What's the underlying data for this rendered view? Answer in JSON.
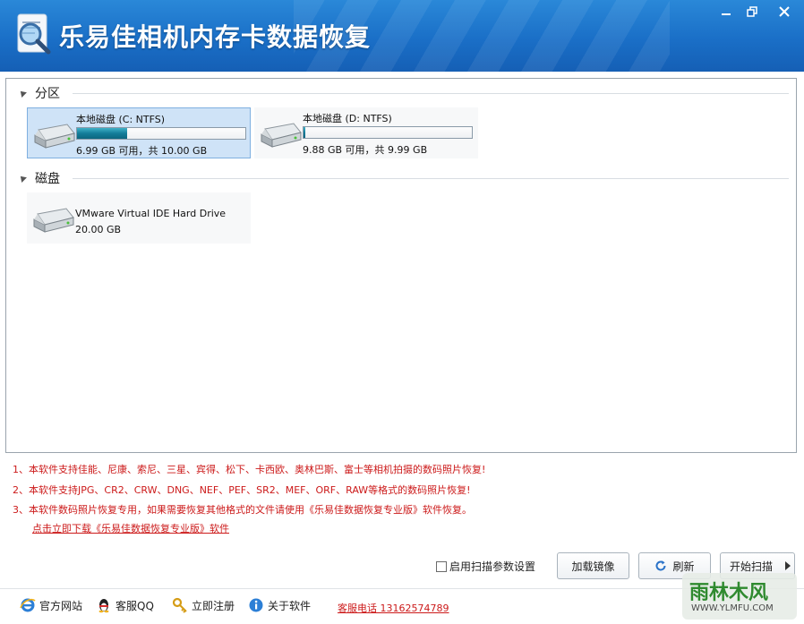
{
  "window": {
    "title": "乐易佳相机内存卡数据恢复",
    "controls": [
      "minimize",
      "restore",
      "close"
    ]
  },
  "partitions": {
    "header": "分区",
    "items": [
      {
        "name": "本地磁盘 (C: NTFS)",
        "info": "6.99 GB 可用，共 10.00 GB",
        "used_fraction": 0.3,
        "selected": true
      },
      {
        "name": "本地磁盘 (D: NTFS)",
        "info": "9.88 GB 可用，共 9.99 GB",
        "used_fraction": 0.01,
        "selected": false
      }
    ]
  },
  "disks": {
    "header": "磁盘",
    "items": [
      {
        "name": "VMware Virtual IDE Hard Drive",
        "info": "20.00 GB"
      }
    ]
  },
  "notes": [
    "1、本软件支持佳能、尼康、索尼、三星、宾得、松下、卡西欧、奥林巴斯、富士等相机拍摄的数码照片恢复!",
    "2、本软件支持JPG、CR2、CRW、DNG、NEF、PEF、SR2、MEF、ORF、RAW等格式的数码照片恢复!",
    "3、本软件数码照片恢复专用，如果需要恢复其他格式的文件请使用《乐易佳数据恢复专业版》软件恢复。"
  ],
  "download_link": "点击立即下载《乐易佳数据恢复专业版》软件",
  "options": {
    "scan_settings_label": "启用扫描参数设置",
    "scan_settings_checked": false
  },
  "buttons": {
    "load_image": "加载镜像",
    "refresh": "刷新",
    "start_scan": "开始扫描"
  },
  "footer": {
    "website": "官方网站",
    "qq": "客服QQ",
    "register": "立即注册",
    "about": "关于软件",
    "hotline": "客服电话 13162574789"
  },
  "watermark": {
    "brand": "雨林木风",
    "url": "WWW.YLMFU.COM"
  },
  "colors": {
    "title_bar": "#1a6fc7",
    "note_red": "#cc1a1a",
    "progress_teal": "#137d99",
    "selection": "#cfe3f7"
  }
}
